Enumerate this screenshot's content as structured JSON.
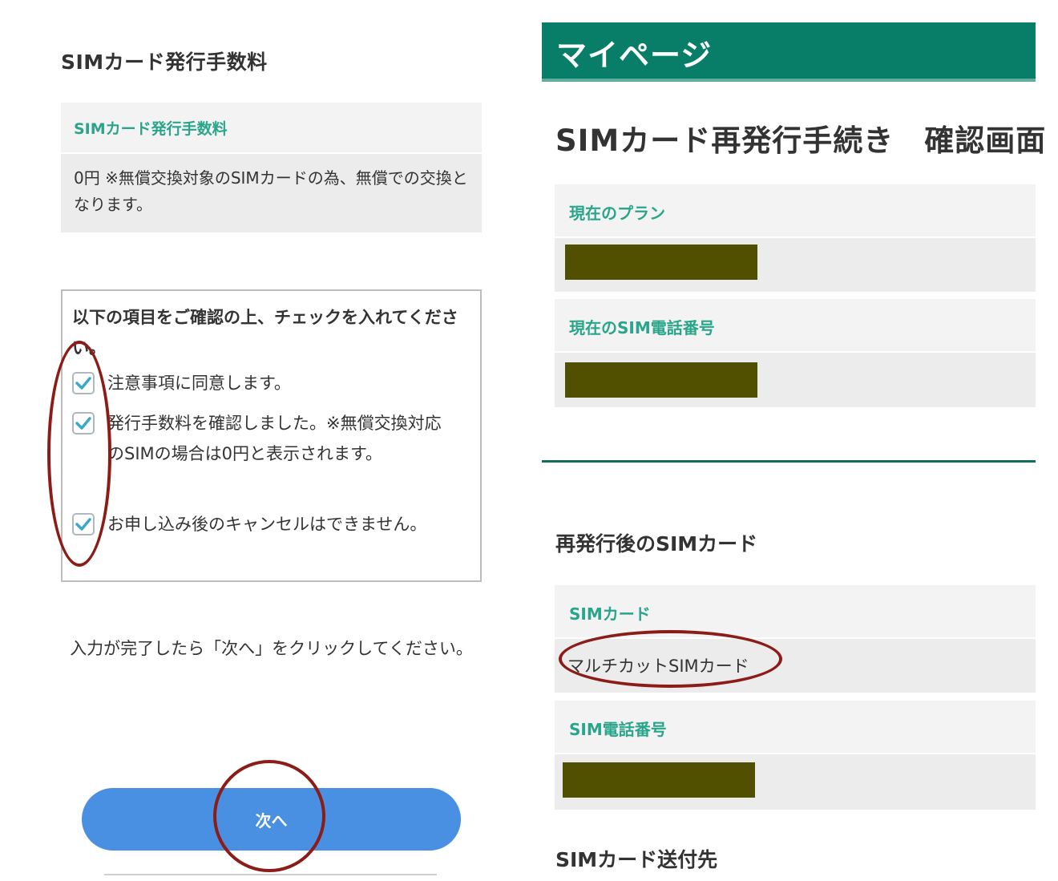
{
  "left": {
    "section_title": "SIMカード発行手数料",
    "fee": {
      "label": "SIMカード発行手数料",
      "value": "0円 ※無償交換対象のSIMカードの為、無償での交換となります。"
    },
    "confirm": {
      "heading": "以下の項目をご確認の上、チェックを入れてください。",
      "items": [
        {
          "label": "注意事項に同意します。",
          "checked": true
        },
        {
          "label": "発行手数料を確認しました。※無償交換対応のSIMの場合は0円と表示されます。",
          "checked": true
        },
        {
          "label": "お申し込み後のキャンセルはできません。",
          "checked": true
        }
      ]
    },
    "instruction": "入力が完了したら「次へ」をクリックしてください。",
    "next_button": "次へ"
  },
  "right": {
    "header_title": "マイページ",
    "page_title": "SIMカード再発行手続き　確認画面",
    "current_plan_label": "現在のプラン",
    "current_number_label": "現在のSIM電話番号",
    "after_section_title": "再発行後のSIMカード",
    "sim_card_label": "SIMカード",
    "sim_card_value": "マルチカットSIMカード",
    "sim_number_label": "SIM電話番号",
    "delivery_title": "SIMカード送付先"
  },
  "colors": {
    "accent_green": "#2aa58b",
    "header_green": "#087e68",
    "button_blue": "#4a90e2",
    "check_blue": "#3aa9c9",
    "annotation_red": "#8b1c17",
    "redaction": "#505000"
  },
  "icons": [
    "checkmark-icon"
  ]
}
